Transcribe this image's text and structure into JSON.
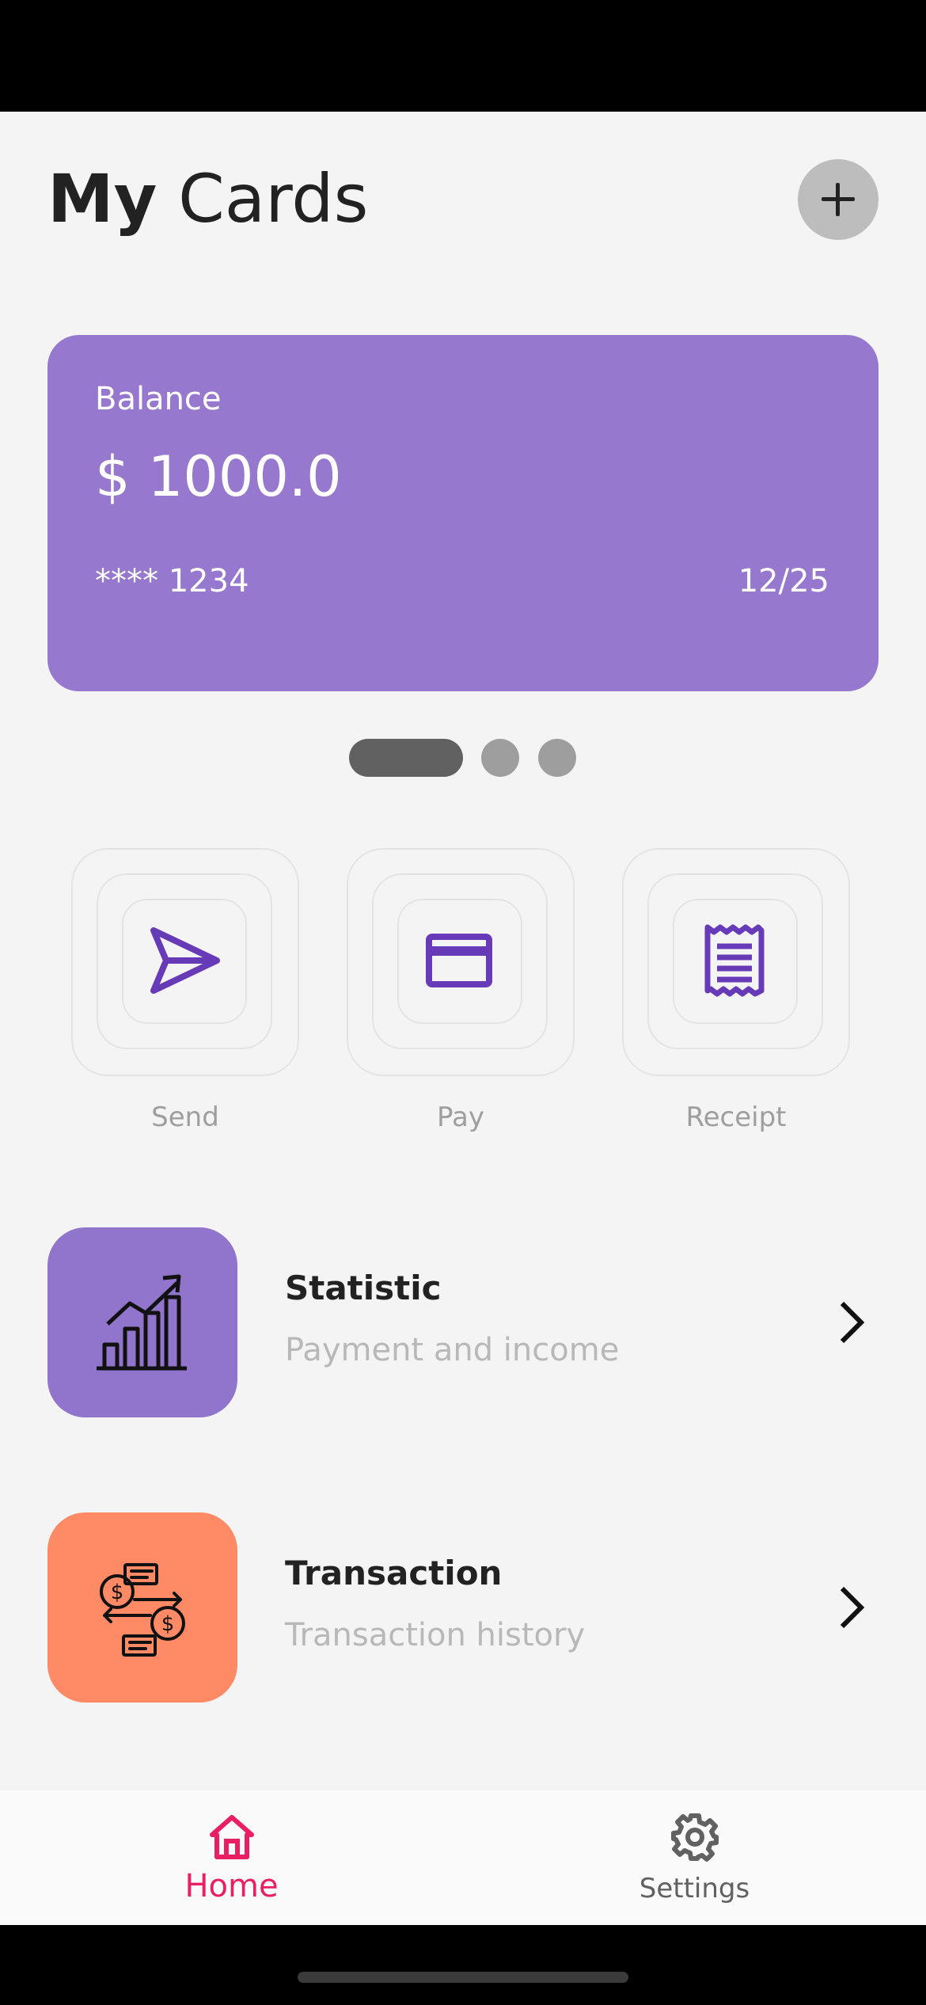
{
  "header": {
    "title_bold": "My",
    "title_rest": "Cards"
  },
  "card": {
    "label": "Balance",
    "balance": "$ 1000.0",
    "number": "**** 1234",
    "expiry": "12/25",
    "color": "#9678ce"
  },
  "pager": {
    "count": 3,
    "active": 0
  },
  "actions": [
    {
      "label": "Send",
      "icon": "send-icon"
    },
    {
      "label": "Pay",
      "icon": "credit-card-icon"
    },
    {
      "label": "Receipt",
      "icon": "receipt-icon"
    }
  ],
  "menu": [
    {
      "title": "Statistic",
      "subtitle": "Payment and income",
      "icon": "chart-icon",
      "color": "#9174cc"
    },
    {
      "title": "Transaction",
      "subtitle": "Transaction history",
      "icon": "transaction-icon",
      "color": "#ff8a65"
    }
  ],
  "nav": {
    "items": [
      {
        "label": "Home",
        "icon": "home-icon",
        "active": true
      },
      {
        "label": "Settings",
        "icon": "gear-icon",
        "active": false
      }
    ],
    "active_color": "#e91e63"
  },
  "colors": {
    "accent": "#673ab7",
    "background": "#f4f4f4"
  }
}
